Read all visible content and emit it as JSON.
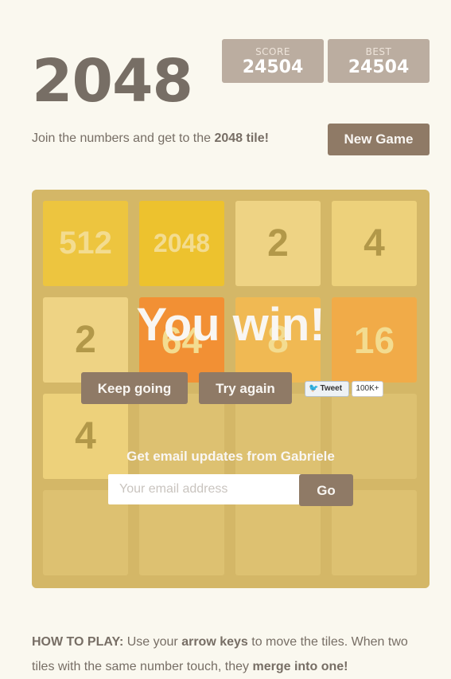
{
  "header": {
    "title": "2048",
    "score_label": "SCORE",
    "score_value": "24504",
    "best_label": "BEST",
    "best_value": "24504"
  },
  "intro": {
    "prefix": "Join the numbers and get to the ",
    "highlight": "2048 tile!"
  },
  "new_game_label": "New Game",
  "board": {
    "rows": [
      [
        "512",
        "2048",
        "2",
        "4"
      ],
      [
        "2",
        "64",
        "8",
        "16"
      ],
      [
        "4",
        "",
        "",
        ""
      ],
      [
        "",
        "",
        "",
        ""
      ]
    ]
  },
  "overlay": {
    "message": "You win!",
    "keep_going_label": "Keep going",
    "try_again_label": "Try again",
    "tweet_label": "Tweet",
    "tweet_count": "100K+",
    "email_title": "Get email updates from Gabriele",
    "email_placeholder": "Your email address",
    "go_label": "Go"
  },
  "colors": {
    "background": "#faf8ef",
    "board": "#bbada0",
    "button": "#8f7a66",
    "win_overlay": "#edc22e"
  },
  "how_to_play": {
    "label": "HOW TO PLAY:",
    "text1": " Use your ",
    "bold1": "arrow keys",
    "text2": " to move the tiles. When two tiles with the same number touch, they ",
    "bold2": "merge into one!"
  }
}
